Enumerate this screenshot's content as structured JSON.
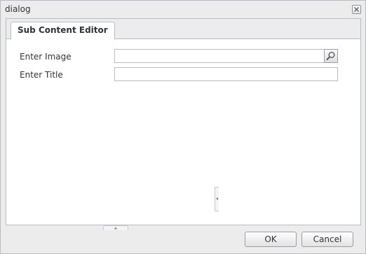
{
  "window": {
    "title": "dialog"
  },
  "tabs": [
    {
      "label": "Sub Content Editor",
      "active": true
    }
  ],
  "form": {
    "image": {
      "label": "Enter Image",
      "value": "",
      "placeholder": ""
    },
    "title": {
      "label": "Enter Title",
      "value": "",
      "placeholder": ""
    }
  },
  "buttons": {
    "ok": "OK",
    "cancel": "Cancel"
  },
  "icons": {
    "close": "close-icon",
    "search": "search-icon",
    "collapse_left": "chevron-left-icon",
    "collapse_up": "chevron-up-icon"
  }
}
